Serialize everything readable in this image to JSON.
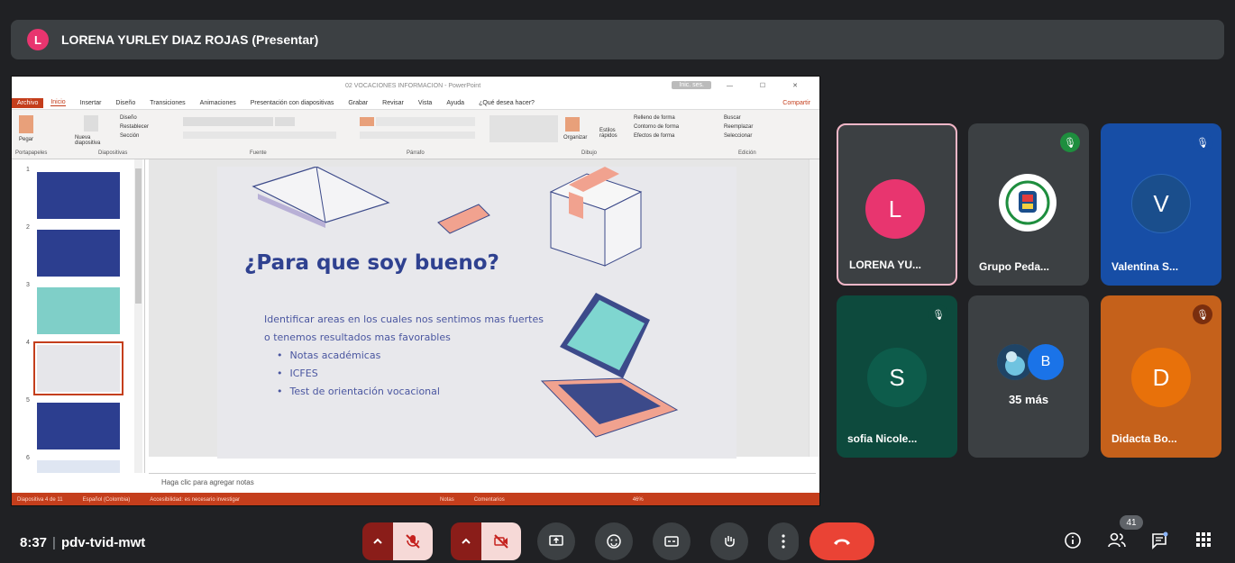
{
  "presenter": {
    "avatar_letter": "L",
    "title": "LORENA YURLEY DIAZ ROJAS (Presentar)"
  },
  "ppt": {
    "doc_title": "02 VOCACIONES INFORMACION - PowerPoint",
    "signin": "Inic. ses.",
    "tabs": [
      "Archivo",
      "Inicio",
      "Insertar",
      "Diseño",
      "Transiciones",
      "Animaciones",
      "Presentación con diapositivas",
      "Grabar",
      "Revisar",
      "Vista",
      "Ayuda",
      "¿Qué desea hacer?"
    ],
    "share_label": "Compartir",
    "ribbon_groups": [
      "Portapapeles",
      "Diapositivas",
      "Fuente",
      "Párrafo",
      "Dibujo",
      "Edición"
    ],
    "ribbon_labels": {
      "paste": "Pegar",
      "new_slide": "Nueva diapositiva",
      "layout": "Diseño",
      "reset": "Restablecer",
      "section": "Sección",
      "organize": "Organizar",
      "quick_styles": "Estilos rápidos",
      "shape_fill": "Relleno de forma",
      "shape_outline": "Contorno de forma",
      "shape_effects": "Efectos de forma",
      "find": "Buscar",
      "replace": "Reemplazar",
      "select": "Seleccionar"
    },
    "thumb_numbers": [
      "1",
      "2",
      "3",
      "4",
      "5",
      "6"
    ],
    "slide": {
      "title": "¿Para que soy bueno?",
      "intro_line1": "Identificar areas en los cuales nos sentimos mas fuertes",
      "intro_line2": "o tenemos resultados mas favorables",
      "bullets": [
        "Notas académicas",
        "ICFES",
        "Test de orientación vocacional"
      ]
    },
    "notes_placeholder": "Haga clic para agregar notas",
    "status": {
      "slide_count": "Diapositiva 4 de 11",
      "language": "Español (Colombia)",
      "accessibility": "Accesibilidad: es necesario investigar",
      "notes": "Notas",
      "comments": "Comentarios",
      "zoom": "46%"
    }
  },
  "tiles": [
    {
      "name": "LORENA YU...",
      "letter": "L",
      "avatar_color": "#e8356f",
      "bg": "#3c4043",
      "muted": false,
      "highlight": true
    },
    {
      "name": "Grupo Peda...",
      "bg": "#3c4043",
      "muted": true,
      "mute_color": "#1e8e3e",
      "logo": true
    },
    {
      "name": "Valentina S...",
      "letter": "V",
      "avatar_color": "#1a4e8c",
      "bg": "#174ea6",
      "muted": true
    },
    {
      "name": "sofia Nicole...",
      "letter": "S",
      "avatar_color": "#0d5c4b",
      "bg": "#0d4a3d",
      "muted": true
    },
    {
      "name": "",
      "more_label": "35 más",
      "bg": "#3c4043",
      "letter": "B"
    },
    {
      "name": "Didacta Bo...",
      "letter": "D",
      "avatar_color": "#e8710a",
      "bg": "#c5611b",
      "muted": true,
      "mute_color": "#7a2e0e"
    }
  ],
  "meeting": {
    "time": "8:37",
    "separator": "|",
    "code": "pdv-tvid-mwt",
    "participants_count": "41"
  },
  "colors": {
    "background": "#202124",
    "end_call": "#ea4335",
    "ppt_accent": "#c43e1c"
  }
}
